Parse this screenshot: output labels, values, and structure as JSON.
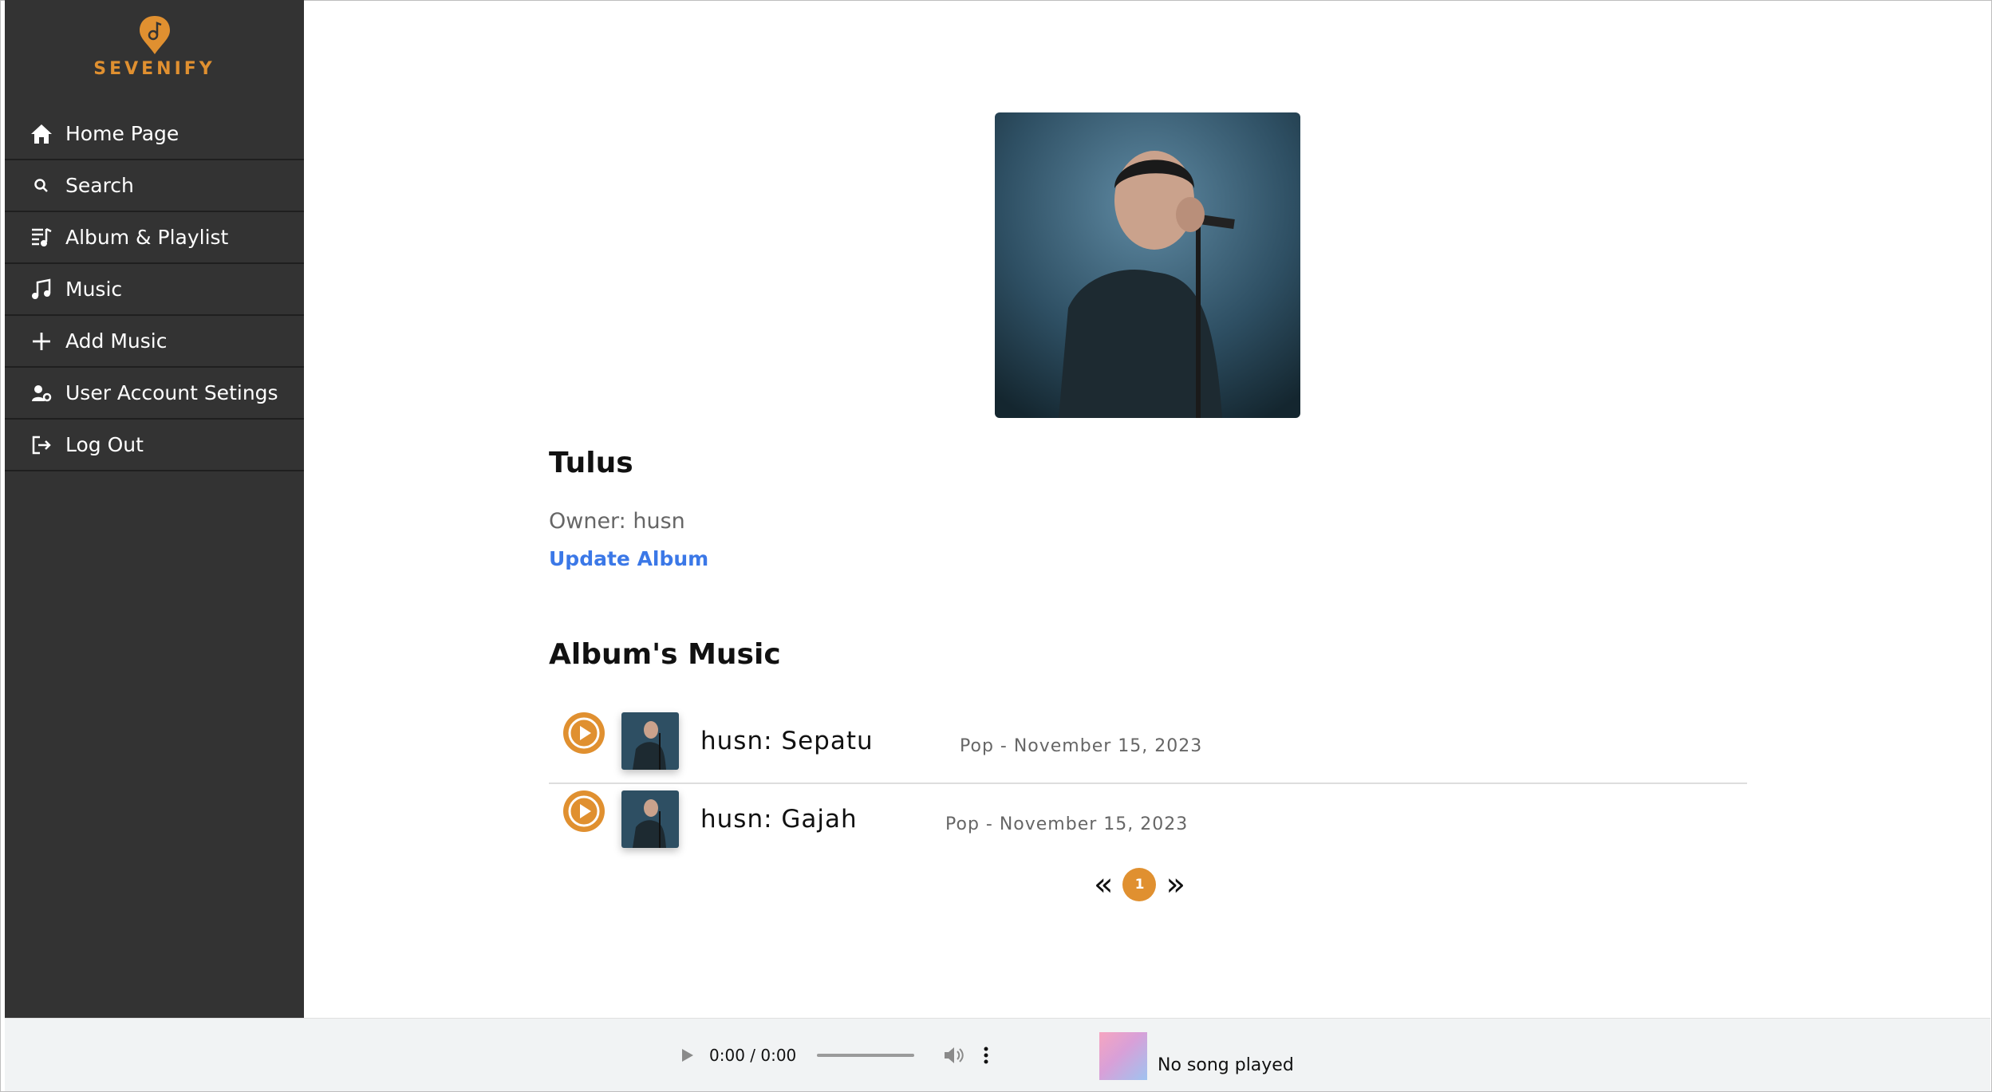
{
  "brand": {
    "name": "SEVENIFY",
    "accent_color": "#e09030"
  },
  "sidebar": {
    "items": [
      {
        "label": "Home Page",
        "icon": "home-icon"
      },
      {
        "label": "Search",
        "icon": "search-icon"
      },
      {
        "label": "Album & Playlist",
        "icon": "playlist-icon"
      },
      {
        "label": "Music",
        "icon": "music-note-icon"
      },
      {
        "label": "Add Music",
        "icon": "plus-icon"
      },
      {
        "label": "User Account Setings",
        "icon": "user-gear-icon"
      },
      {
        "label": "Log Out",
        "icon": "logout-icon"
      }
    ]
  },
  "album": {
    "title": "Tulus",
    "owner": "Owner: husn",
    "update_label": "Update Album",
    "music_heading": "Album's Music",
    "tracks": [
      {
        "name": "husn: Sepatu",
        "meta": "Pop - November 15, 2023"
      },
      {
        "name": "husn: Gajah",
        "meta": "Pop - November 15, 2023"
      }
    ],
    "pagination": {
      "prev": "«",
      "current": "1",
      "next": "»"
    }
  },
  "player": {
    "time": "0:00 / 0:00",
    "now_playing": "No song played"
  }
}
